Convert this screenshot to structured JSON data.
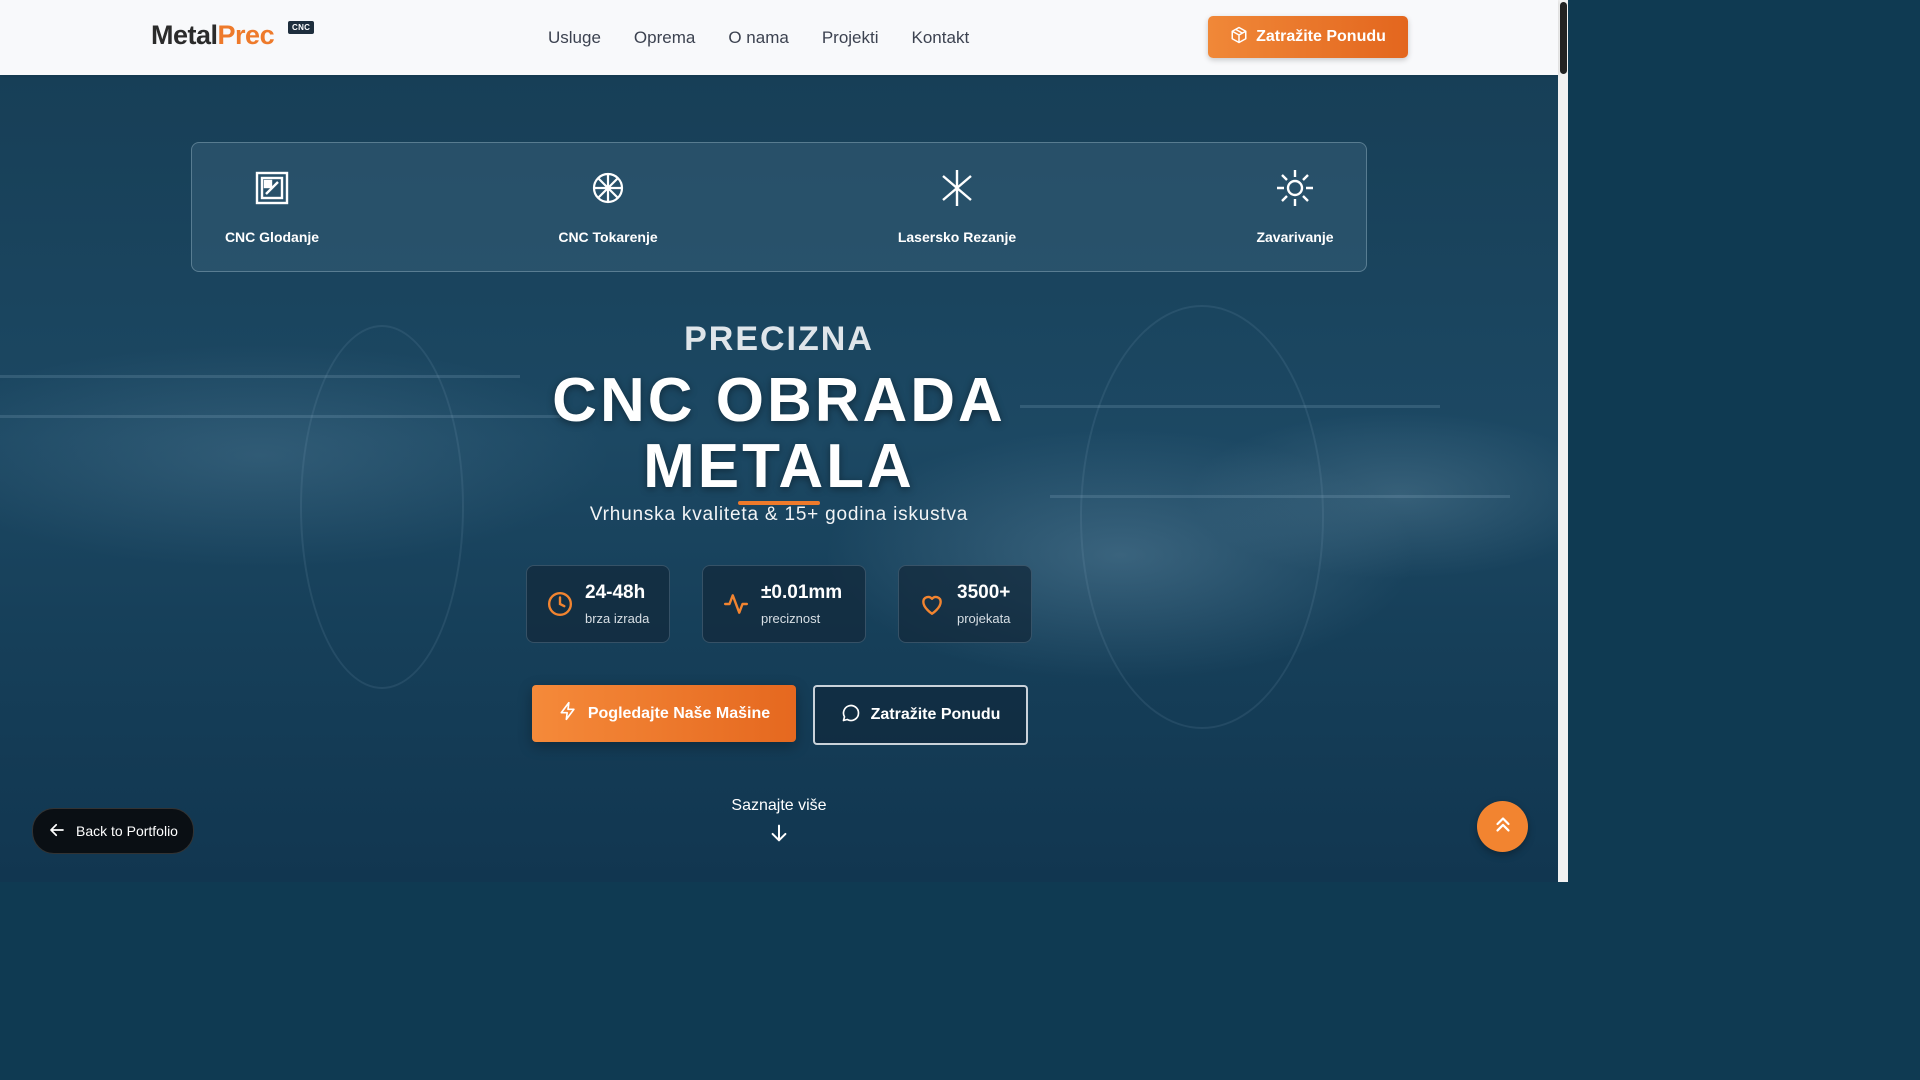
{
  "header": {
    "logo_main": "Metal",
    "logo_accent": "Prec",
    "logo_badge": "CNC",
    "nav": [
      "Usluge",
      "Oprema",
      "O nama",
      "Projekti",
      "Kontakt"
    ],
    "cta_label": "Zatražite Ponudu",
    "cta_icon": "box-icon"
  },
  "services": [
    {
      "label": "CNC Glodanje",
      "icon": "milling-icon"
    },
    {
      "label": "CNC Tokarenje",
      "icon": "wheel-icon"
    },
    {
      "label": "Lasersko Rezanje",
      "icon": "asterisk-icon"
    },
    {
      "label": "Zavarivanje",
      "icon": "sun-icon"
    }
  ],
  "hero": {
    "supertitle": "PRECIZNA",
    "title_line1": "CNC OBRADA",
    "title_line2": "METALA",
    "subtitle": "Vrhunska kvaliteta & 15+ godina iskustva"
  },
  "stats": [
    {
      "value": "24-48h",
      "caption": "brza izrada",
      "icon": "clock-icon"
    },
    {
      "value": "±0.01mm",
      "caption": "preciznost",
      "icon": "activity-icon"
    },
    {
      "value": "3500+",
      "caption": "projekata",
      "icon": "heart-icon"
    }
  ],
  "buttons": {
    "primary": "Pogledajte Naše Mašine",
    "secondary": "Zatražite Ponudu"
  },
  "learn_more": "Saznajte više",
  "back_label": "Back to Portfolio",
  "colors": {
    "accent": "#ee7a2b",
    "hero_bg": "#1a4560",
    "header_bg": "#f8f9fb"
  }
}
